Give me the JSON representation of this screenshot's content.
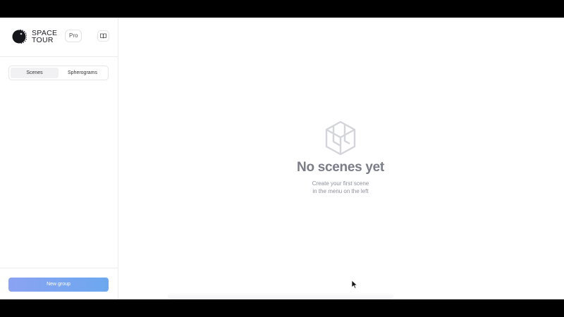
{
  "brand": {
    "line1": "SPACE",
    "line2": "TOUR",
    "badge": "Pro"
  },
  "icons": {
    "logo": "space-tour-logo",
    "docs": "book-open-icon",
    "empty": "cube-icon",
    "cursor": "mouse-pointer"
  },
  "tabs": [
    {
      "label": "Scenes",
      "active": true
    },
    {
      "label": "Spherograms",
      "active": false
    }
  ],
  "footer": {
    "new_group_label": "New group"
  },
  "empty_state": {
    "title": "No scenes yet",
    "subtitle_line1": "Create your first scene",
    "subtitle_line2": "in the menu on the left"
  },
  "colors": {
    "accent_start": "#8aa3f2",
    "accent_end": "#6ca8ef",
    "muted_text": "#7a7c88"
  }
}
